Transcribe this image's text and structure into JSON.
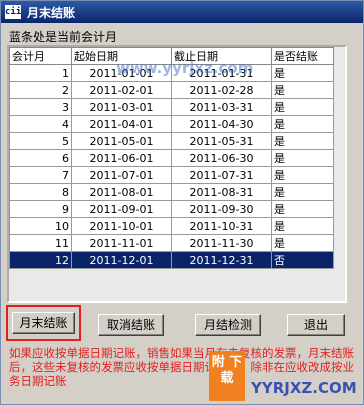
{
  "window": {
    "icon": "cii",
    "title": "月末结账"
  },
  "hint": "蓝条处是当前会计月",
  "table": {
    "columns": [
      "会计月",
      "起始日期",
      "截止日期",
      "是否结账"
    ],
    "rows": [
      [
        "1",
        "2011-01-01",
        "2011-01-31",
        "是"
      ],
      [
        "2",
        "2011-02-01",
        "2011-02-28",
        "是"
      ],
      [
        "3",
        "2011-03-01",
        "2011-03-31",
        "是"
      ],
      [
        "4",
        "2011-04-01",
        "2011-04-30",
        "是"
      ],
      [
        "5",
        "2011-05-01",
        "2011-05-31",
        "是"
      ],
      [
        "6",
        "2011-06-01",
        "2011-06-30",
        "是"
      ],
      [
        "7",
        "2011-07-01",
        "2011-07-31",
        "是"
      ],
      [
        "8",
        "2011-08-01",
        "2011-08-31",
        "是"
      ],
      [
        "9",
        "2011-09-01",
        "2011-09-30",
        "是"
      ],
      [
        "10",
        "2011-10-01",
        "2011-10-31",
        "是"
      ],
      [
        "11",
        "2011-11-01",
        "2011-11-30",
        "是"
      ],
      [
        "12",
        "2011-12-01",
        "2011-12-31",
        "否"
      ]
    ]
  },
  "buttons": {
    "month_end": "月末结账",
    "cancel": "取消结账",
    "check": "月结检测",
    "exit": "退出"
  },
  "note": "如果应收按单据日期记账，销售如果当月有未复核的发票，月末结账后，这些未复核的发票应收按单据日期记账了，除非在应收改成按业务日期记账",
  "watermarks": {
    "top": "www.yyrjxz.com",
    "bottom": "YYRJXZ.COM",
    "badge": "附 下载"
  }
}
